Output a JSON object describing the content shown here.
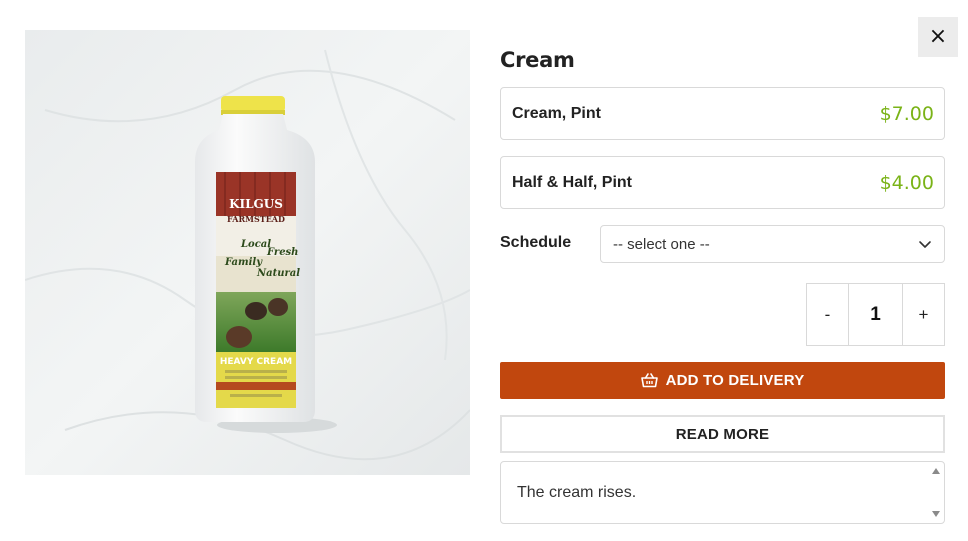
{
  "modal": {
    "close_icon": "close-icon",
    "close_glyph": "×"
  },
  "product": {
    "title": "Cream",
    "image_label": {
      "brand_top": "KILGUS",
      "brand_bottom": "FARMSTEAD",
      "tag1": "Local",
      "tag2": "Fresh",
      "tag3": "Family",
      "tag4": "Natural",
      "type": "HEAVY CREAM"
    },
    "variants": [
      {
        "name": "Cream, Pint",
        "price": "$7.00"
      },
      {
        "name": "Half & Half, Pint",
        "price": "$4.00"
      }
    ],
    "schedule": {
      "label": "Schedule",
      "selected": "-- select one --"
    },
    "quantity": {
      "minus": "-",
      "value": "1",
      "plus": "+"
    },
    "add_button": {
      "label": "ADD TO DELIVERY",
      "icon": "basket-icon"
    },
    "read_more_button": {
      "label": "READ MORE"
    },
    "description": "The cream rises."
  },
  "colors": {
    "price": "#7ab317",
    "accent": "#c1470e"
  }
}
